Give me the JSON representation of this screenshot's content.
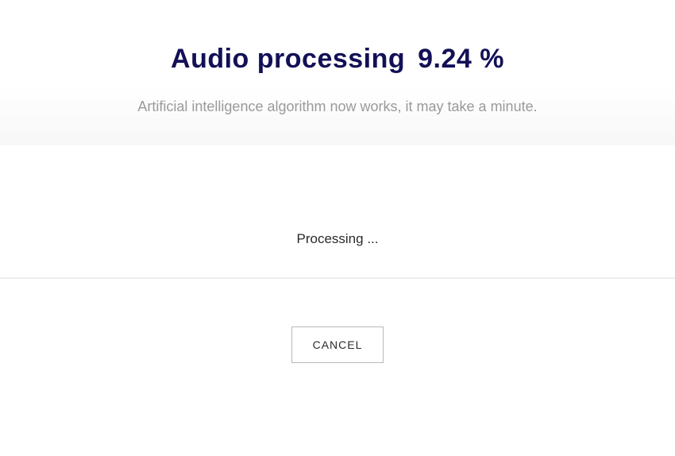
{
  "header": {
    "title_prefix": "Audio processing",
    "percent_display": "9.24 %",
    "subtitle": "Artificial intelligence algorithm now works, it may take a minute."
  },
  "status": {
    "text": "Processing ..."
  },
  "actions": {
    "cancel_label": "CANCEL"
  }
}
